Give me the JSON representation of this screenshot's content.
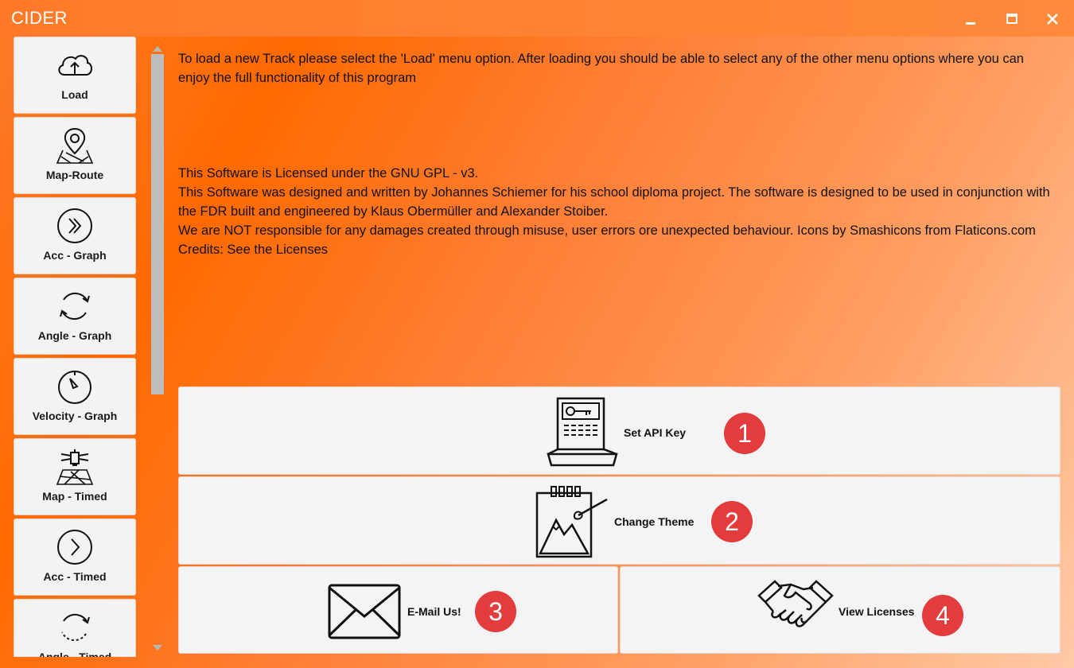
{
  "window": {
    "title": "CIDER",
    "minimize_icon": "minimize-icon",
    "maximize_icon": "maximize-icon",
    "close_icon": "close-icon"
  },
  "sidebar": {
    "items": [
      {
        "label": "Load",
        "icon": "cloud-upload-icon"
      },
      {
        "label": "Map-Route",
        "icon": "map-pin-icon"
      },
      {
        "label": "Acc - Graph",
        "icon": "double-chevron-right-icon"
      },
      {
        "label": "Angle - Graph",
        "icon": "rotate-icon"
      },
      {
        "label": "Velocity - Graph",
        "icon": "speedometer-icon"
      },
      {
        "label": "Map - Timed",
        "icon": "satellite-map-icon"
      },
      {
        "label": "Acc - Timed",
        "icon": "chevron-right-icon"
      },
      {
        "label": "Angle - Timed",
        "icon": "rotate-dashed-icon"
      }
    ]
  },
  "info": {
    "intro": "To load a new Track please select the 'Load' menu option. After loading you should be able to select any of the other menu options where you can enjoy the full functionality of this program",
    "license_lines": [
      "This Software is Licensed under the GNU GPL - v3.",
      "This Software was designed and written by Johannes Schiemer for his school diploma project. The software is designed to be used in conjunction with the FDR built and engineered by Klaus Obermüller and Alexander Stoiber.",
      "We are NOT responsible for any damages created through misuse, user errors ore unexpected behaviour. Icons by Smashicons from Flaticons.com",
      "Credits: See the Licenses"
    ]
  },
  "actions": [
    {
      "label": "Set API Key",
      "badge": "1",
      "icon": "api-key-laptop-icon"
    },
    {
      "label": "Change Theme",
      "badge": "2",
      "icon": "theme-canvas-icon"
    },
    {
      "label": "E-Mail Us!",
      "badge": "3",
      "icon": "envelope-icon"
    },
    {
      "label": "View Licenses",
      "badge": "4",
      "icon": "handshake-icon"
    }
  ],
  "colors": {
    "accent": "#ff6a00",
    "badge": "#e43c3c",
    "tile": "#f4f4f4"
  }
}
